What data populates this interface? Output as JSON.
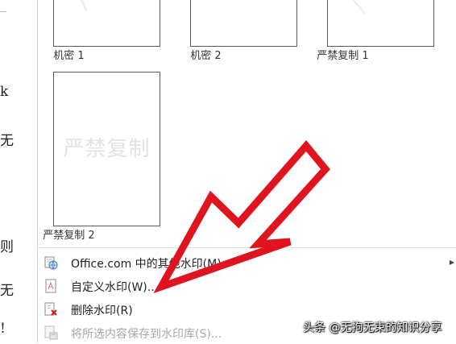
{
  "document": {
    "chars": [
      "k",
      "无",
      "则",
      "无",
      "!"
    ]
  },
  "gallery": {
    "thumbnails": [
      {
        "label": "机密 1"
      },
      {
        "label": "机密 2"
      },
      {
        "label": "严禁复制 1"
      },
      {
        "label": "严禁复制 2",
        "watermark_text": "严禁复制"
      }
    ]
  },
  "menu": {
    "items": [
      {
        "label": "Office.com 中的其他水印(M)",
        "icon": "office-globe-icon",
        "enabled": true,
        "has_submenu": true
      },
      {
        "label": "自定义水印(W)...",
        "icon": "custom-watermark-icon",
        "enabled": true
      },
      {
        "label": "删除水印(R)",
        "icon": "remove-watermark-icon",
        "enabled": true
      },
      {
        "label": "将所选内容保存到水印库(S)...",
        "icon": "save-to-gallery-icon",
        "enabled": false
      }
    ]
  },
  "annotation": {
    "arrow_color": "#e0141e",
    "caption": "头条 @无拘无束的知识分享"
  }
}
